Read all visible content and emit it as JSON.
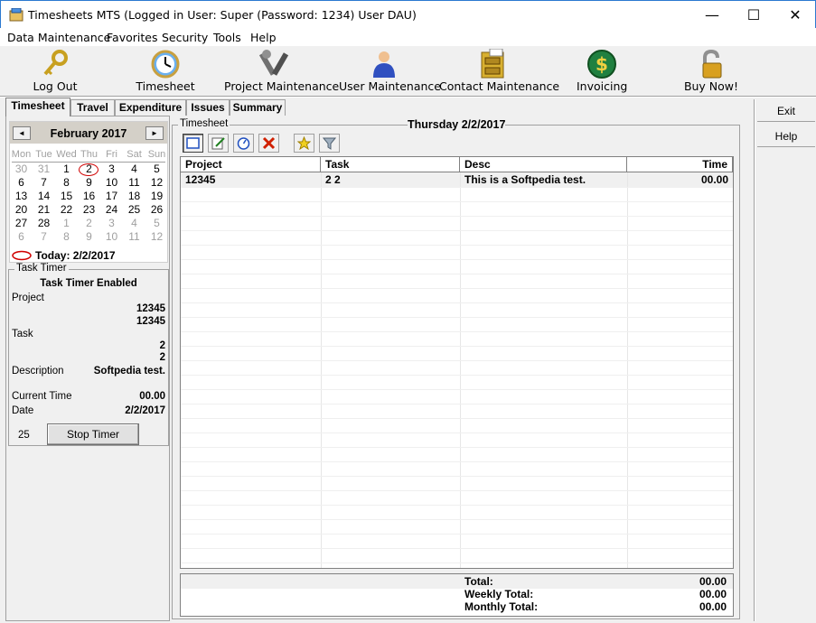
{
  "window": {
    "title": "Timesheets MTS (Logged in User: Super (Password: 1234) User DAU)",
    "minimize": "—",
    "maximize": "☐",
    "close": "✕"
  },
  "menu": [
    "Data Maintenance",
    "Favorites",
    "Security",
    "Tools",
    "Help"
  ],
  "toolbar": [
    {
      "label": "Log Out",
      "icon": "key-icon"
    },
    {
      "label": "Timesheet",
      "icon": "clock-icon"
    },
    {
      "label": "Project Maintenance",
      "icon": "tools-icon"
    },
    {
      "label": "User Maintenance",
      "icon": "user-icon"
    },
    {
      "label": "Contact Maintenance",
      "icon": "filing-cabinet-icon"
    },
    {
      "label": "Invoicing",
      "icon": "dollar-icon"
    },
    {
      "label": "Buy Now!",
      "icon": "lock-icon"
    }
  ],
  "tabs": [
    "Timesheet",
    "Travel",
    "Expenditure",
    "Issues",
    "Summary"
  ],
  "calendar": {
    "month": "February 2017",
    "prev": "◄",
    "next": "►",
    "dow": [
      "Mon",
      "Tue",
      "Wed",
      "Thu",
      "Fri",
      "Sat",
      "Sun"
    ],
    "weeks": [
      [
        "30",
        "31",
        "1",
        "2",
        "3",
        "4",
        "5"
      ],
      [
        "6",
        "7",
        "8",
        "9",
        "10",
        "11",
        "12"
      ],
      [
        "13",
        "14",
        "15",
        "16",
        "17",
        "18",
        "19"
      ],
      [
        "20",
        "21",
        "22",
        "23",
        "24",
        "25",
        "26"
      ],
      [
        "27",
        "28",
        "1",
        "2",
        "3",
        "4",
        "5"
      ],
      [
        "6",
        "7",
        "8",
        "9",
        "10",
        "11",
        "12"
      ]
    ],
    "today": "Today: 2/2/2017"
  },
  "task_timer": {
    "legend": "Task Timer",
    "status": "Task Timer Enabled",
    "project_label": "Project",
    "project_value1": "12345",
    "project_value2": "12345",
    "task_label": "Task",
    "task_value1": "2",
    "task_value2": "2",
    "description_label": "Description",
    "description_value": "Softpedia test.",
    "current_time_label": "Current Time",
    "current_time_value": "00.00",
    "date_label": "Date",
    "date_value": "2/2/2017",
    "counter": "25",
    "stop_button": "Stop Timer"
  },
  "timesheet": {
    "legend": "Timesheet",
    "date": "Thursday 2/2/2017",
    "tools": [
      "select-icon",
      "edit-icon",
      "timer-icon",
      "delete-icon",
      "favorite-icon",
      "filter-icon"
    ],
    "columns": [
      "Project",
      "Task",
      "Desc",
      "Time"
    ],
    "rows": [
      {
        "project": "12345",
        "task": "2 2",
        "desc": "This is a Softpedia test.",
        "time": "00.00"
      }
    ],
    "totals": [
      {
        "label": "Total:",
        "value": "00.00"
      },
      {
        "label": "Weekly Total:",
        "value": "00.00"
      },
      {
        "label": "Monthly Total:",
        "value": "00.00"
      }
    ]
  },
  "side": {
    "exit": "Exit",
    "help": "Help"
  },
  "colors": {
    "accent": "#2b79d0",
    "today_circle": "#d00000"
  }
}
